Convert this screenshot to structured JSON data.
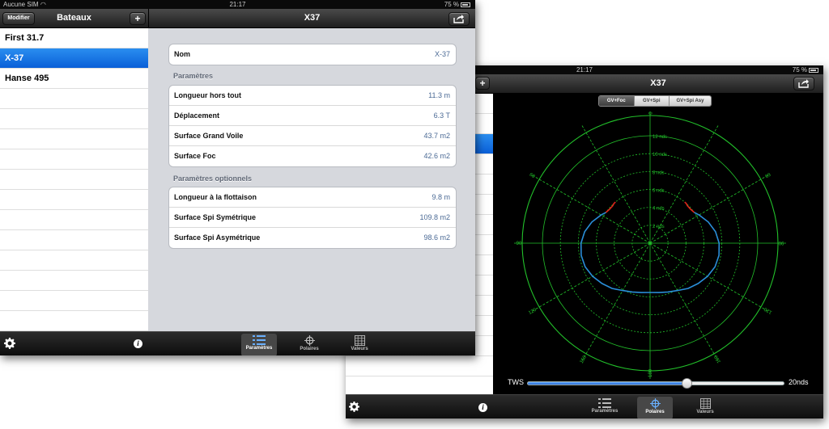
{
  "left_screen": {
    "status": {
      "carrier": "Aucune SIM",
      "time": "21:17",
      "battery": "75 %"
    },
    "master": {
      "edit_label": "Modifier",
      "title": "Bateaux",
      "add_label": "+",
      "boats": [
        {
          "name": "First 31.7",
          "selected": false
        },
        {
          "name": "X-37",
          "selected": true
        },
        {
          "name": "Hanse 495",
          "selected": false
        }
      ]
    },
    "detail": {
      "title": "X37",
      "name_label": "Nom",
      "name_value": "X-37",
      "section_params": "Paramètres",
      "params": [
        {
          "label": "Longueur hors tout",
          "value": "11.3 m"
        },
        {
          "label": "Déplacement",
          "value": "6.3 T"
        },
        {
          "label": "Surface Grand Voile",
          "value": "43.7 m2"
        },
        {
          "label": "Surface Foc",
          "value": "42.6 m2"
        }
      ],
      "section_optional": "Paramètres optionnels",
      "optional": [
        {
          "label": "Longueur à la flottaison",
          "value": "9.8 m"
        },
        {
          "label": "Surface Spi Symétrique",
          "value": "109.8 m2"
        },
        {
          "label": "Surface Spi Asymétrique",
          "value": "98.6 m2"
        }
      ]
    },
    "tabs": [
      {
        "label": "Paramètres",
        "icon": "list-icon",
        "active": true
      },
      {
        "label": "Polaires",
        "icon": "crosshair-icon",
        "active": false
      },
      {
        "label": "Valeurs",
        "icon": "table-icon",
        "active": false
      }
    ]
  },
  "right_screen": {
    "status": {
      "time": "21:17",
      "battery": "75 %"
    },
    "title": "X37",
    "add_label": "+",
    "segments": [
      {
        "label": "GV+Foc",
        "active": true
      },
      {
        "label": "GV+Spi",
        "active": false
      },
      {
        "label": "GV+Spi Asy",
        "active": false
      }
    ],
    "polar": {
      "ring_labels": [
        "2 nds",
        "4 nds",
        "6 nds",
        "8 nds",
        "10 nds",
        "12 nds"
      ],
      "angle_labels": {
        "top": "0",
        "bottom": "180",
        "left": "90",
        "right": "90",
        "ul": "60",
        "ur": "60",
        "ll": "120",
        "lr": "120",
        "bl": "150",
        "br": "150"
      },
      "colors": {
        "grid": "#22c02a",
        "upwind": "#e0241b",
        "downwind": "#2a8ed8",
        "background": "#000000"
      },
      "curve": {
        "unit": "nds",
        "upwind": [
          [
            40,
            6.0
          ],
          [
            42,
            6.0
          ],
          [
            45,
            5.9
          ],
          [
            50,
            5.9
          ],
          [
            55,
            6.0
          ]
        ],
        "downwind": [
          [
            55,
            6.0
          ],
          [
            60,
            6.3
          ],
          [
            70,
            6.9
          ],
          [
            80,
            7.4
          ],
          [
            90,
            7.7
          ],
          [
            100,
            7.8
          ],
          [
            110,
            7.7
          ],
          [
            120,
            7.4
          ],
          [
            130,
            7.0
          ],
          [
            140,
            6.6
          ],
          [
            150,
            6.1
          ],
          [
            160,
            5.8
          ],
          [
            170,
            5.6
          ],
          [
            180,
            5.5
          ]
        ]
      }
    },
    "tws": {
      "label": "TWS",
      "value_label": "20nds",
      "fraction": 0.62
    },
    "tabs": [
      {
        "label": "Paramètres",
        "icon": "list-icon",
        "active": false
      },
      {
        "label": "Polaires",
        "icon": "crosshair-icon",
        "active": true
      },
      {
        "label": "Valeurs",
        "icon": "table-icon",
        "active": false
      }
    ],
    "visible_boat_selected": true
  }
}
